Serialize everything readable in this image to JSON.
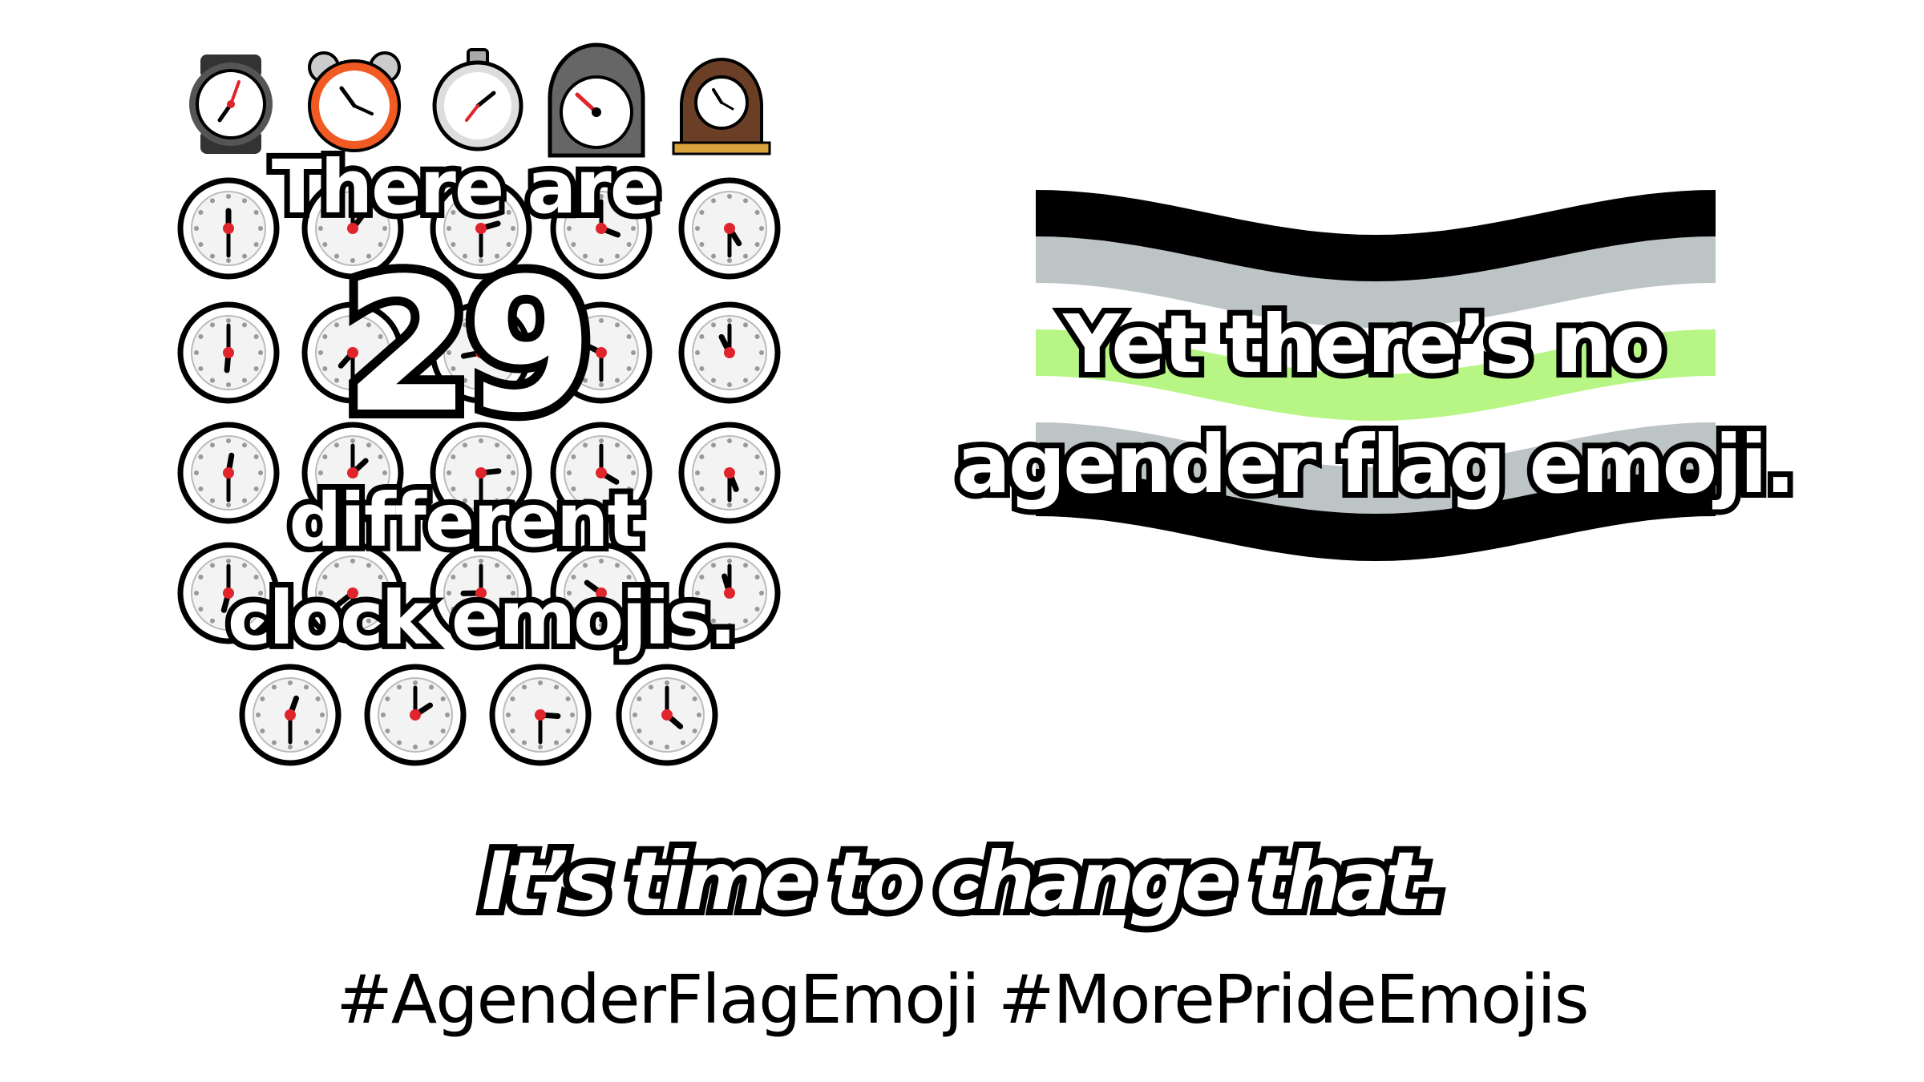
{
  "left_panel": {
    "line1": "There are",
    "number": "29",
    "line3": "different",
    "line4": "clock emojis."
  },
  "right_panel": {
    "line1": "Yet there’s no",
    "line2": "agender flag emoji.",
    "flag_stripes": [
      "#000000",
      "#bcc4c6",
      "#ffffff",
      "#b7f684",
      "#ffffff",
      "#bcc4c6",
      "#000000"
    ]
  },
  "footer": {
    "tagline": "It’s time to change that.",
    "hashtags": "#AgenderFlagEmoji #MorePrideEmojis"
  },
  "icons": {
    "top_row": [
      "watch-icon",
      "alarm-clock-icon",
      "stopwatch-icon",
      "timer-clock-icon",
      "mantelpiece-clock-icon"
    ],
    "clock_faces": "clock-face-icon"
  },
  "colors": {
    "background": "#ffffff",
    "text_fill": "#ffffff",
    "text_outline": "#000000",
    "clock_hand_red": "#e0242c",
    "alarm_orange": "#f15a22"
  }
}
